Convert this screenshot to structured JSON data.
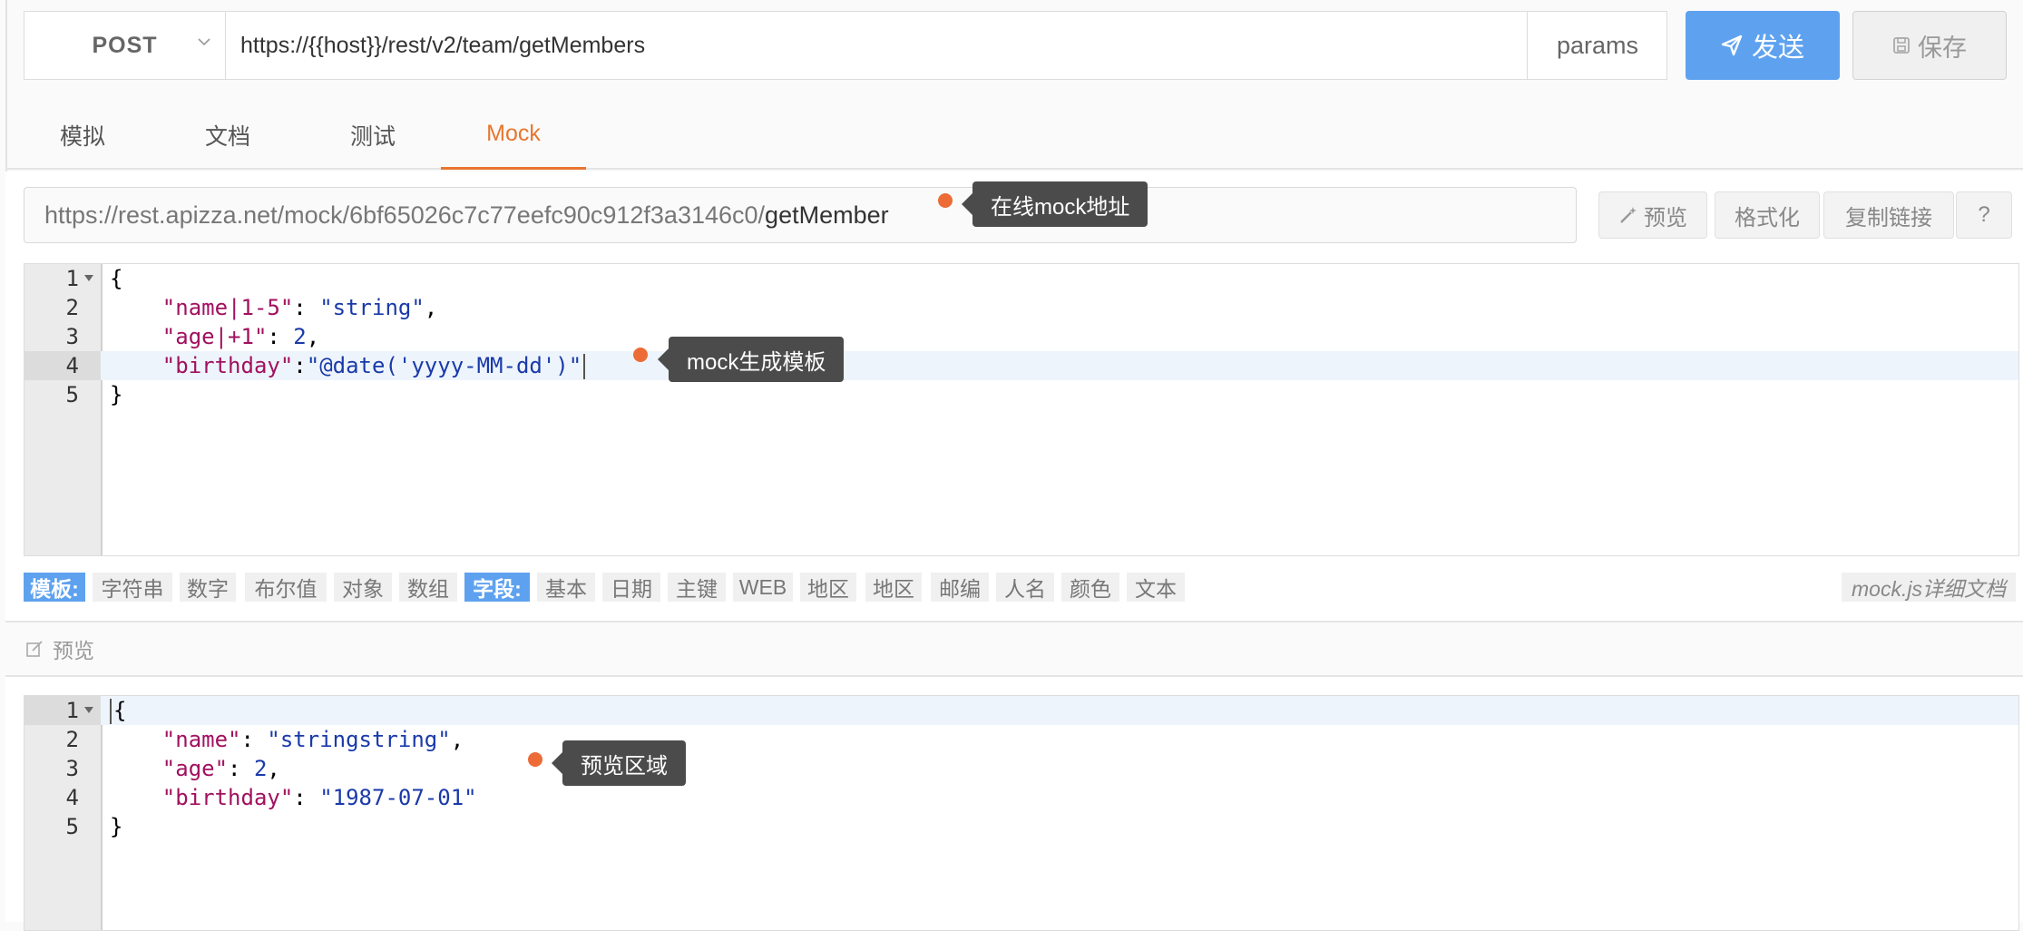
{
  "request": {
    "method": "POST",
    "url": "https://{{host}}/rest/v2/team/getMembers",
    "params_label": "params",
    "send_label": "发送",
    "save_label": "保存"
  },
  "tabs": [
    {
      "label": "模拟"
    },
    {
      "label": "文档"
    },
    {
      "label": "测试"
    },
    {
      "label": "Mock",
      "active": true
    }
  ],
  "mock": {
    "url_prefix": "https://rest.apizza.net/mock/6bf65026c7c77eefc90c912f3a3146c0/",
    "url_tail": "getMember",
    "tools": {
      "preview": "预览",
      "format": "格式化",
      "copy_link": "复制链接",
      "help": "?"
    }
  },
  "template_editor": {
    "line_numbers": [
      "1",
      "2",
      "3",
      "4",
      "5"
    ],
    "l1": "{",
    "l2_key": "\"name|1-5\"",
    "l2_sep": ": ",
    "l2_val": "\"string\"",
    "l2_end": ",",
    "l3_key": "\"age|+1\"",
    "l3_sep": ": ",
    "l3_val": "2",
    "l3_end": ",",
    "l4_key": "\"birthday\"",
    "l4_sep": ":",
    "l4_val": "\"@date('yyyy-MM-dd')\"",
    "l5": "}"
  },
  "snippets": {
    "template_label": "模板:",
    "template_items": [
      "字符串",
      "数字",
      "布尔值",
      "对象",
      "数组"
    ],
    "field_label": "字段:",
    "field_items": [
      "基本",
      "日期",
      "主键",
      "WEB",
      "地区",
      "地区",
      "邮编",
      "人名",
      "颜色",
      "文本"
    ],
    "doc_link": "mock.js详细文档"
  },
  "preview": {
    "header_label": "预览",
    "line_numbers": [
      "1",
      "2",
      "3",
      "4",
      "5"
    ],
    "l1": "{",
    "l2_key": "\"name\"",
    "l2_sep": ": ",
    "l2_val": "\"stringstring\"",
    "l2_end": ",",
    "l3_key": "\"age\"",
    "l3_sep": ": ",
    "l3_val": "2",
    "l3_end": ",",
    "l4_key": "\"birthday\"",
    "l4_sep": ": ",
    "l4_val": "\"1987-07-01\"",
    "l5": "}"
  },
  "annotations": {
    "online_mock": "在线mock地址",
    "mock_template": "mock生成模板",
    "preview_area": "预览区域"
  },
  "colors": {
    "accent": "#e8762f",
    "primary": "#5ea2ef",
    "annotation_dot": "#ec6b37",
    "tooltip_bg": "#4b4b4b"
  }
}
